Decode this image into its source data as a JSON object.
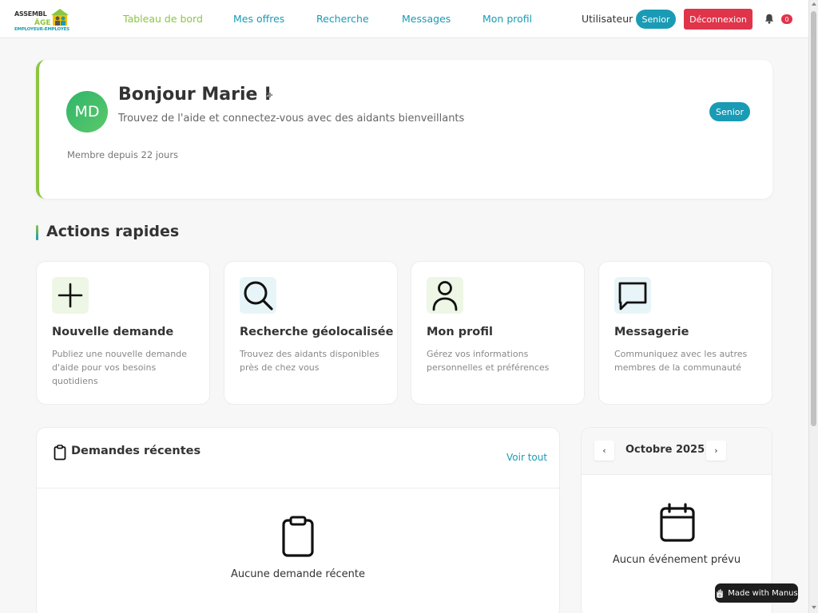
{
  "header": {
    "logo": {
      "line1": "ASSEMBL",
      "line2": "ÂGE",
      "line3": "EMPLOYEUR-EMPLOYÉS"
    },
    "nav": [
      {
        "label": "Tableau de bord",
        "active": true
      },
      {
        "label": "Mes offres",
        "active": false
      },
      {
        "label": "Recherche",
        "active": false
      },
      {
        "label": "Messages",
        "active": false
      },
      {
        "label": "Mon profil",
        "active": false
      }
    ],
    "user_label": "Utilisateur",
    "role_badge": "Senior",
    "logout_label": "Déconnexion",
    "notification_count": "0",
    "icons": {
      "notifications": "bell-icon"
    }
  },
  "welcome": {
    "initials": "MD",
    "greeting": "Bonjour Marie !",
    "subtitle": "Trouvez de l'aide et connectez-vous avec des aidants bienveillants",
    "member_since": "Membre depuis 22 jours",
    "role_badge": "Senior",
    "icons": {
      "voice": "microphone-icon"
    }
  },
  "quick_actions": {
    "title": "Actions rapides",
    "cards": [
      {
        "title": "Nouvelle demande",
        "description": "Publiez une nouvelle demande d'aide pour vos besoins quotidiens",
        "icon": "plus-icon"
      },
      {
        "title": "Recherche géolocalisée",
        "description": "Trouvez des aidants disponibles près de chez vous",
        "icon": "search-icon"
      },
      {
        "title": "Mon profil",
        "description": "Gérez vos informations personnelles et préférences",
        "icon": "user-icon"
      },
      {
        "title": "Messagerie",
        "description": "Communiquez avec les autres membres de la communauté",
        "icon": "message-icon"
      }
    ]
  },
  "recent_requests": {
    "title": "Demandes récentes",
    "see_all": "Voir tout",
    "empty_text": "Aucune demande récente",
    "icons": {
      "header": "clipboard-icon",
      "empty": "clipboard-icon"
    }
  },
  "calendar": {
    "prev": "‹",
    "next": "›",
    "month": "Octobre 2025",
    "empty_text": "Aucun événement prévu",
    "icons": {
      "empty": "calendar-icon"
    }
  },
  "badge": {
    "label": "Made with Manus",
    "icon": "manus-icon"
  },
  "colors": {
    "brand_teal": "#1a9bb5",
    "brand_green": "#8cc63f",
    "danger": "#e0344a"
  }
}
